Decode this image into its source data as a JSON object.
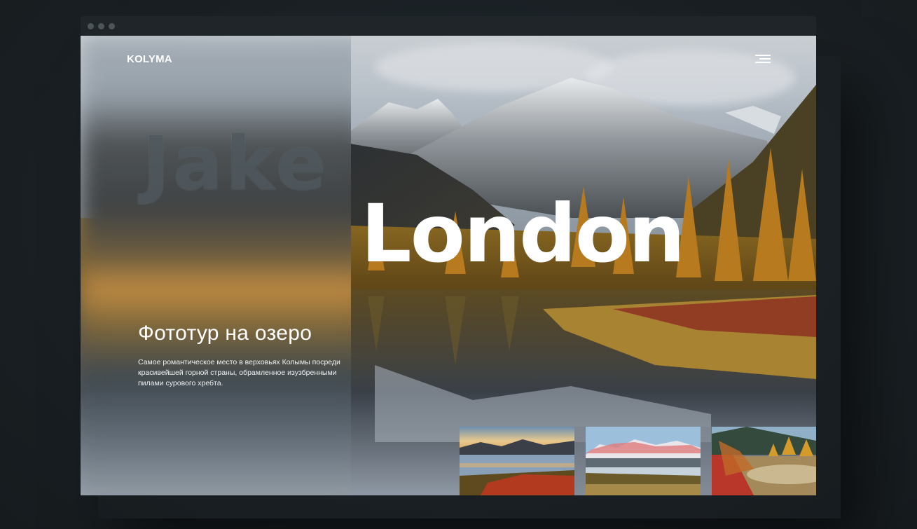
{
  "site": {
    "logo": "KOLYMA",
    "menu_icon": "hamburger-icon"
  },
  "hero": {
    "ghost_word": "Jake",
    "headline": "London",
    "tour_title": "Фототур на озеро",
    "tour_description": "Самое романтическое место в верховьях Колымы посреди красивейшей горной страны, обрамленное изузбренными пилами сурового хребта."
  },
  "gallery": {
    "thumbnails": [
      "lake-sunset-thumb",
      "pink-peaks-thumb",
      "autumn-shore-thumb"
    ]
  },
  "colors": {
    "background": "#1a2024",
    "autumn_gold": "#c98a2a",
    "text": "#ffffff"
  }
}
